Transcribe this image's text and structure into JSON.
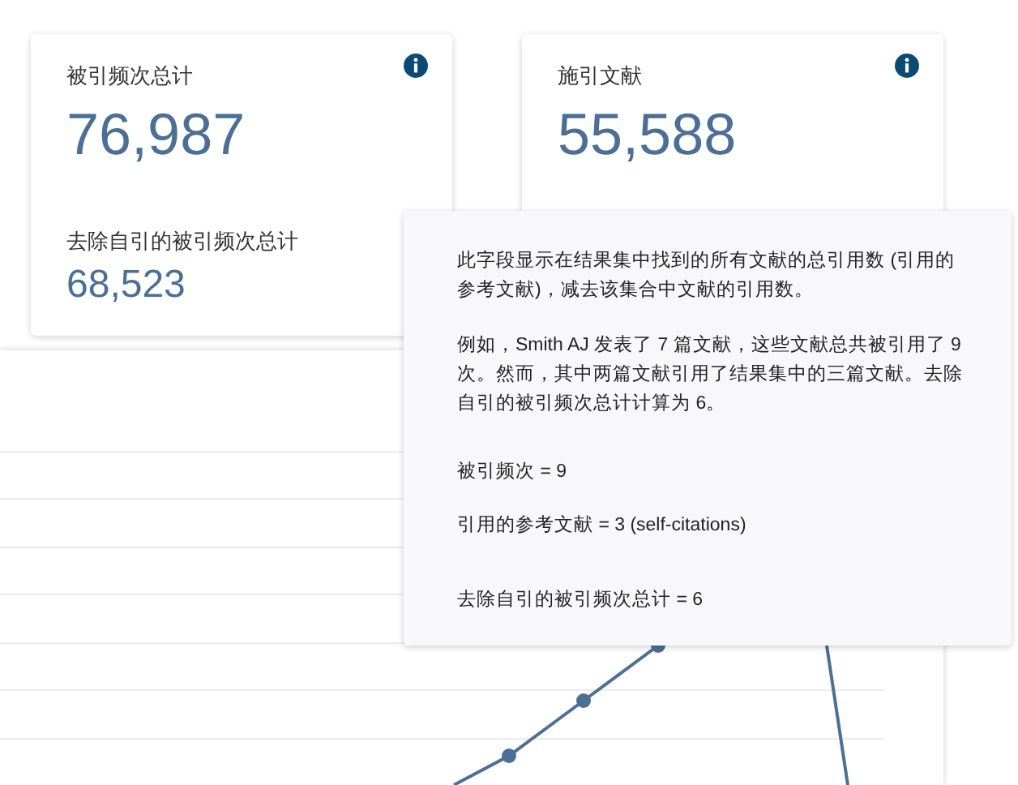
{
  "cards": [
    {
      "label": "被引频次总计",
      "value": "76,987",
      "sub_label": "去除自引的被引频次总计",
      "sub_value": "68,523"
    },
    {
      "label": "施引文献",
      "value": "55,588"
    }
  ],
  "tooltip": {
    "paragraphs": [
      "此字段显示在结果集中找到的所有文献的总引用数 (引用的参考文献)，减去该集合中文献的引用数。",
      "例如，Smith AJ 发表了 7 篇文献，这些文献总共被引用了 9 次。然而，其中两篇文献引用了结果集中的三篇文献。去除自引的被引频次总计计算为 6。",
      "被引频次 = 9",
      "引用的参考文献 = 3 (self-citations)",
      "去除自引的被引频次总计 = 6"
    ]
  }
}
